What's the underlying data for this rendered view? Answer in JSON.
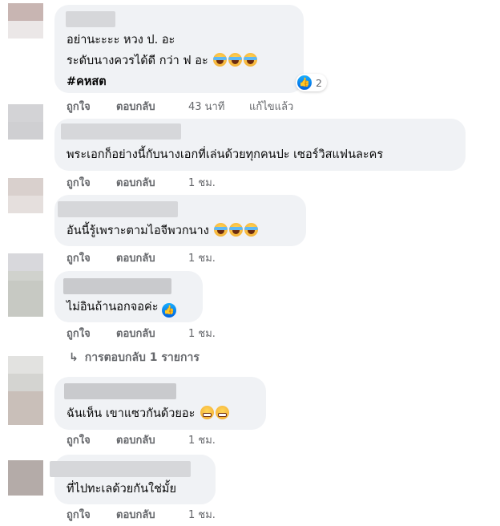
{
  "comments": [
    {
      "lines": [
        "อย่านะะะะ หวง ป. อะ",
        "ระดับนางควรได้ดี กว่า ฟ อะ"
      ],
      "line2_emojis": [
        "laughing-tears-emoji",
        "laughing-tears-emoji",
        "laughing-tears-emoji"
      ],
      "hashtag": "#คหสต",
      "reaction": {
        "icon": "like-icon",
        "count": "2"
      },
      "actions": {
        "like": "ถูกใจ",
        "reply": "ตอบกลับ",
        "time": "43 นาที",
        "edited": "แก้ไขแล้ว"
      }
    },
    {
      "lines": [
        "พระเอกก็อย่างนี้กับนางเอกที่เล่นด้วยทุกคนปะ เซอร์วิสแฟนละคร"
      ],
      "actions": {
        "like": "ถูกใจ",
        "reply": "ตอบกลับ",
        "time": "1 ชม."
      }
    },
    {
      "lines": [
        "อันนี้รู้เพราะตามไอจีพวกนาง"
      ],
      "line_emojis": [
        "rolling-laughing-emoji",
        "rolling-laughing-emoji",
        "rolling-laughing-emoji"
      ],
      "actions": {
        "like": "ถูกใจ",
        "reply": "ตอบกลับ",
        "time": "1 ชม."
      }
    },
    {
      "lines": [
        "ไม่อินถ้านอกจอค่ะ"
      ],
      "inline_icon": "like-icon",
      "actions": {
        "like": "ถูกใจ",
        "reply": "ตอบกลับ",
        "time": "1 ชม."
      }
    },
    {
      "lines": [
        "ฉันเห็น เขาแซวกันด้วยอะ"
      ],
      "line_emojis": [
        "grimacing-emoji",
        "grimacing-emoji"
      ],
      "actions": {
        "like": "ถูกใจ",
        "reply": "ตอบกลับ",
        "time": "1 ชม."
      }
    },
    {
      "lines": [
        "ที่ไปทะเลด้วยกันใช่มั้ย"
      ],
      "actions": {
        "like": "ถูกใจ",
        "reply": "ตอบกลับ",
        "time": "1 ชม."
      }
    }
  ],
  "replies_link": {
    "icon": "reply-arrow-icon",
    "label": "การตอบกลับ 1 รายการ"
  },
  "colors": {
    "bubble": "#f0f2f5",
    "secondary_text": "#65676b",
    "primary_text": "#050505",
    "like_blue": "#0866ff"
  }
}
